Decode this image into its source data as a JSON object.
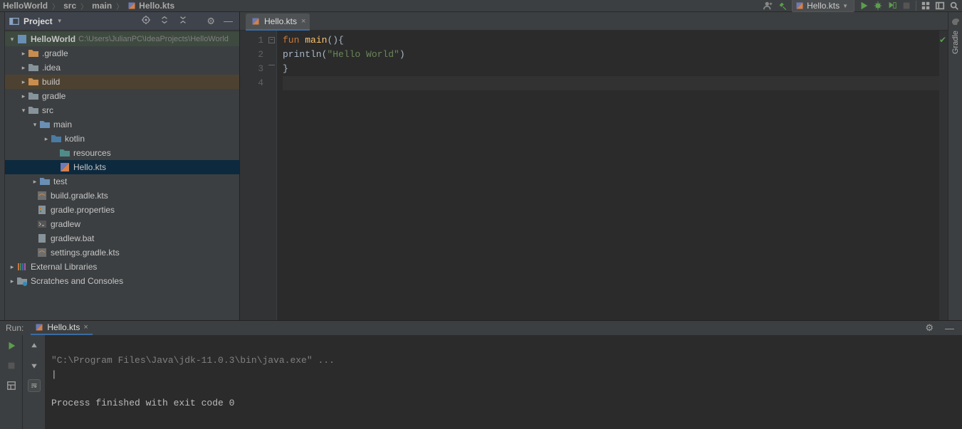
{
  "breadcrumb": {
    "project": "HelloWorld",
    "src": "src",
    "main": "main",
    "file": "Hello.kts"
  },
  "runConfig": {
    "label": "Hello.kts"
  },
  "projectPanel": {
    "title": "Project",
    "tree": {
      "rootName": "HelloWorld",
      "rootPath": "C:\\Users\\JulianPC\\IdeaProjects\\HelloWorld",
      "gradleDir": ".gradle",
      "ideaDir": ".idea",
      "buildDir": "build",
      "gradleDir2": "gradle",
      "srcDir": "src",
      "mainDir": "main",
      "kotlinDir": "kotlin",
      "resourcesDir": "resources",
      "helloFile": "Hello.kts",
      "testDir": "test",
      "buildGradle": "build.gradle.kts",
      "gradleProps": "gradle.properties",
      "gradlew": "gradlew",
      "gradlewBat": "gradlew.bat",
      "settingsGradle": "settings.gradle.kts",
      "extLib": "External Libraries",
      "scratches": "Scratches and Consoles"
    }
  },
  "editor": {
    "tabName": "Hello.kts",
    "lines": [
      "1",
      "2",
      "3",
      "4"
    ],
    "code": {
      "funKw": "fun",
      "mainName": "main",
      "parens": "(){",
      "indent": "    ",
      "println": "println",
      "openParen": "(",
      "string": "\"Hello World\"",
      "closeParen": ")",
      "closeBrace": "}"
    }
  },
  "rightStripe": {
    "gradle": "Gradle"
  },
  "runPanel": {
    "label": "Run:",
    "tabName": "Hello.kts",
    "console": {
      "cmd": "\"C:\\Program Files\\Java\\jdk-11.0.3\\bin\\java.exe\" ...",
      "caret": "|",
      "blank": "",
      "exit": "Process finished with exit code 0"
    }
  }
}
